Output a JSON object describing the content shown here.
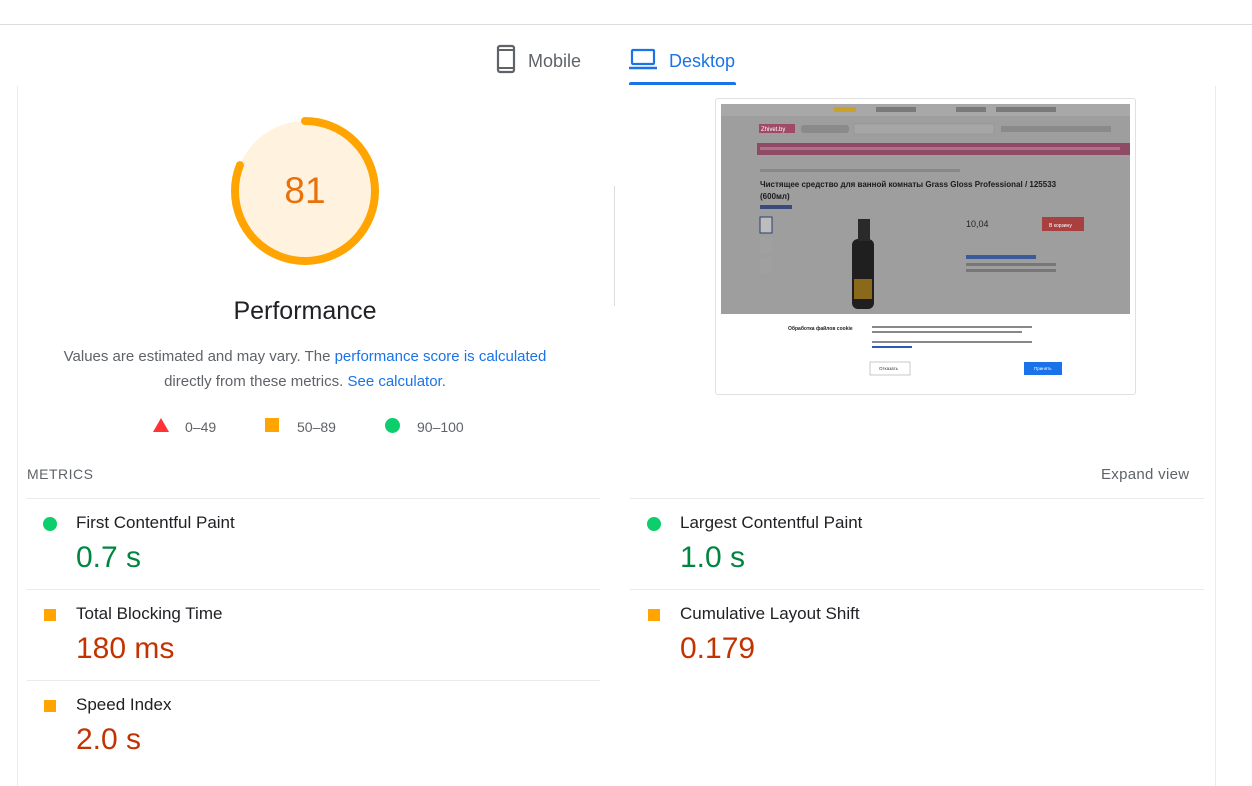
{
  "tabs": {
    "mobile_label": "Mobile",
    "desktop_label": "Desktop",
    "active": "Desktop"
  },
  "score": {
    "value": "81",
    "fraction": 0.81,
    "category": "Performance",
    "color": "#ffa400",
    "text_color": "#e8710a"
  },
  "description": {
    "prefix": "Values are estimated and may vary. The ",
    "link1": "performance score is calculated",
    "middle": " directly from these metrics. ",
    "link2": "See calculator",
    "suffix": "."
  },
  "legend": [
    {
      "range": "0–49",
      "shape": "triangle",
      "color": "#ff3333"
    },
    {
      "range": "50–89",
      "shape": "square",
      "color": "#ffa400"
    },
    {
      "range": "90–100",
      "shape": "circle",
      "color": "#0cce6b"
    }
  ],
  "metrics": {
    "header": "METRICS",
    "expand_label": "Expand view",
    "fcp": {
      "name": "First Contentful Paint",
      "value": "0.7 s",
      "status": "good"
    },
    "lcp": {
      "name": "Largest Contentful Paint",
      "value": "1.0 s",
      "status": "good"
    },
    "tbt": {
      "name": "Total Blocking Time",
      "value": "180 ms",
      "status": "average"
    },
    "cls": {
      "name": "Cumulative Layout Shift",
      "value": "0.179",
      "status": "average"
    },
    "si": {
      "name": "Speed Index",
      "value": "2.0 s",
      "status": "average"
    }
  },
  "screenshot": {
    "logo": "Zhivet.by",
    "product_title_line1": "Чистящее средство для ванной комнаты Grass Gloss Professional / 125533",
    "product_title_line2": "(600мл)",
    "price": "10,04",
    "cart_button": "В корзину",
    "cookie_title": "Обработка файлов cookie",
    "reject_button": "Отказать",
    "accept_button": "Принять",
    "nav_color": "#d6336c",
    "accept_color": "#1a73e8"
  }
}
